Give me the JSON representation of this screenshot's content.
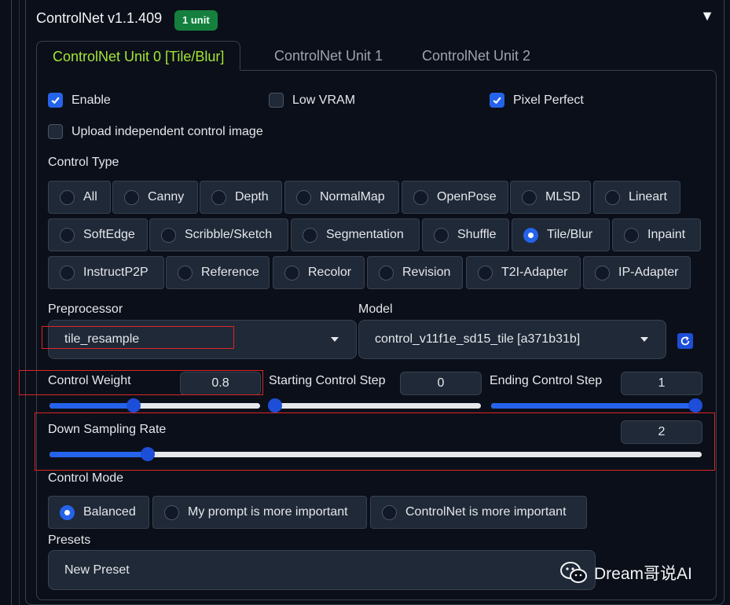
{
  "accordion": {
    "title": "ControlNet v1.1.409",
    "badge": "1 unit",
    "toggle": "▼"
  },
  "tabs": [
    {
      "label": "ControlNet Unit 0 [Tile/Blur]",
      "active": true
    },
    {
      "label": "ControlNet Unit 1",
      "active": false
    },
    {
      "label": "ControlNet Unit 2",
      "active": false
    }
  ],
  "checkboxes": {
    "enable": {
      "label": "Enable",
      "checked": true
    },
    "low_vram": {
      "label": "Low VRAM",
      "checked": false
    },
    "pixel_perfect": {
      "label": "Pixel Perfect",
      "checked": true
    },
    "upload_independent": {
      "label": "Upload independent control image",
      "checked": false
    }
  },
  "control_type": {
    "label": "Control Type",
    "options": [
      "All",
      "Canny",
      "Depth",
      "NormalMap",
      "OpenPose",
      "MLSD",
      "Lineart",
      "SoftEdge",
      "Scribble/Sketch",
      "Segmentation",
      "Shuffle",
      "Tile/Blur",
      "Inpaint",
      "InstructP2P",
      "Reference",
      "Recolor",
      "Revision",
      "T2I-Adapter",
      "IP-Adapter"
    ],
    "selected": "Tile/Blur"
  },
  "preprocessor": {
    "label": "Preprocessor",
    "value": "tile_resample"
  },
  "model": {
    "label": "Model",
    "value": "control_v11f1e_sd15_tile [a371b31b]"
  },
  "sliders": {
    "control_weight": {
      "label": "Control Weight",
      "value": "0.8",
      "fraction": 0.4
    },
    "starting_step": {
      "label": "Starting Control Step",
      "value": "0",
      "fraction": 0.0
    },
    "ending_step": {
      "label": "Ending Control Step",
      "value": "1",
      "fraction": 1.0
    },
    "down_sampling": {
      "label": "Down Sampling Rate",
      "value": "2",
      "fraction": 0.15
    }
  },
  "control_mode": {
    "label": "Control Mode",
    "options": [
      "Balanced",
      "My prompt is more important",
      "ControlNet is more important"
    ],
    "selected": "Balanced"
  },
  "presets": {
    "label": "Presets",
    "value": "New Preset"
  },
  "watermark": {
    "text": "Dream哥说AI"
  },
  "colors": {
    "accent": "#2563eb",
    "tab_active": "#a3e635",
    "badge": "#15803d",
    "highlight_box": "#dc2626"
  }
}
